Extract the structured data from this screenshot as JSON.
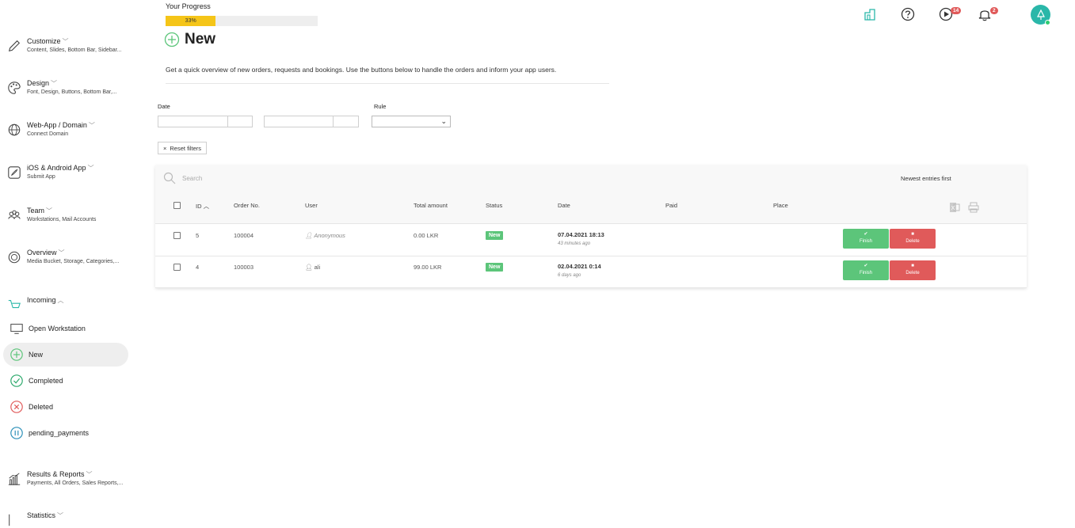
{
  "progress": {
    "label": "Your Progress",
    "percent": 33,
    "text": "33%"
  },
  "page": {
    "title": "New",
    "intro": "Get a quick overview of new orders, requests and bookings. Use the buttons below to handle the orders and inform your app users."
  },
  "filters": {
    "date_label": "Date",
    "rule_label": "Rule",
    "reset_label": "Reset filters"
  },
  "table": {
    "search_placeholder": "Search",
    "sort_label": "Newest entries first",
    "columns": [
      "ID",
      "Order No.",
      "User",
      "Total amount",
      "Status",
      "Date",
      "Paid",
      "Place"
    ],
    "rows": [
      {
        "id": "5",
        "order_no": "100004",
        "user": "Anonymous",
        "total": "0.00 LKR",
        "status": "New",
        "date": "07.04.2021 18:13",
        "date_ago": "43 minutes ago",
        "finish": "Finish",
        "delete": "Delete"
      },
      {
        "id": "4",
        "order_no": "100003",
        "user": "ali",
        "total": "99.00 LKR",
        "status": "New",
        "date": "02.04.2021 0:14",
        "date_ago": "6 days ago",
        "finish": "Finish",
        "delete": "Delete"
      }
    ]
  },
  "sidebar": {
    "groups": [
      {
        "title": "Customize",
        "sub": "Content, Slides, Bottom Bar, Sidebar..."
      },
      {
        "title": "Design",
        "sub": "Font, Design, Buttons, Bottom Bar,..."
      },
      {
        "title": "Web-App / Domain",
        "sub": "Connect Domain"
      },
      {
        "title": "iOS & Android App",
        "sub": "Submit App"
      },
      {
        "title": "Team",
        "sub": "Workstations, Mail Accounts"
      },
      {
        "title": "Overview",
        "sub": "Media Bucket, Storage, Categories,..."
      },
      {
        "title": "Incoming",
        "sub": ""
      },
      {
        "title": "Results & Reports",
        "sub": "Payments, All Orders, Sales Reports,..."
      },
      {
        "title": "Statistics",
        "sub": ""
      }
    ],
    "incoming_items": [
      "Open Workstation",
      "New",
      "Completed",
      "Deleted",
      "pending_payments"
    ]
  },
  "header": {
    "video_count": "14",
    "notification_count": "2"
  },
  "colors": {
    "accent_green": "#5cc57a",
    "danger_red": "#e05a5a",
    "progress_yellow": "#f5c518",
    "avatar_teal": "#2ab7a9"
  }
}
